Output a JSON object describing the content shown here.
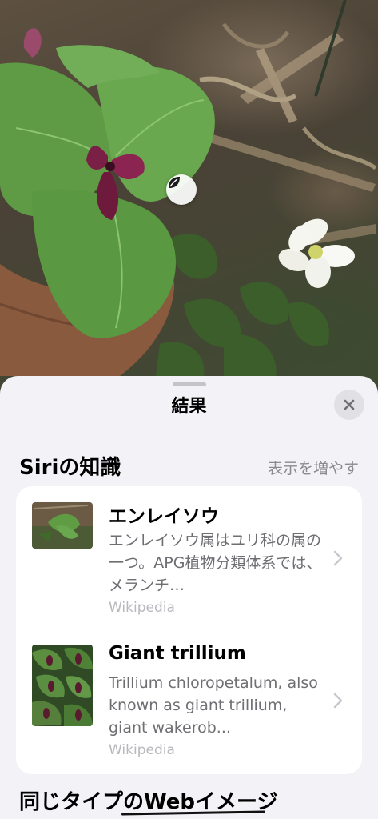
{
  "sheet": {
    "title": "結果",
    "close_icon": "xmark-icon",
    "section_title": "Siriの知識",
    "show_more_label": "表示を増やす",
    "next_section_title": "同じタイプのWebイメージ"
  },
  "results": [
    {
      "title": "エンレイソウ",
      "description": "エンレイソウ属はユリ科の属の一つ。APG植物分類体系では、メランチ…",
      "source": "Wikipedia"
    },
    {
      "title": "Giant trillium",
      "description": "Trillium chloropetalum, also known as giant trillium, giant wakerob...",
      "source": "Wikipedia"
    }
  ],
  "photo": {
    "badge_icon": "leaf-visual-lookup-icon"
  }
}
